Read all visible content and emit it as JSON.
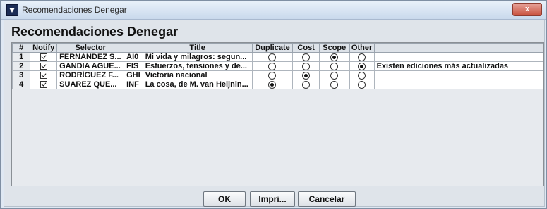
{
  "window": {
    "title": "Recomendaciones Denegar",
    "close_label": "x"
  },
  "heading": "Recomendaciones Denegar",
  "table": {
    "columns": [
      "#",
      "Notify",
      "Selector",
      "",
      "Title",
      "Duplicate",
      "Cost",
      "Scope",
      "Other",
      ""
    ],
    "rows": [
      {
        "num": "1",
        "notify": true,
        "selector": "FERNÁNDEZ S...",
        "code": "AI0",
        "title": "Mi vida y milagros: segun...",
        "choice": "Scope",
        "note": ""
      },
      {
        "num": "2",
        "notify": true,
        "selector": "GANDIA AGUE...",
        "code": "FIS",
        "title": "Esfuerzos, tensiones y de...",
        "choice": "Other",
        "note": "Existen ediciones más actualizadas"
      },
      {
        "num": "3",
        "notify": true,
        "selector": "RODRÍGUEZ F...",
        "code": "GHI",
        "title": "Victoria nacional",
        "choice": "Cost",
        "note": ""
      },
      {
        "num": "4",
        "notify": true,
        "selector": "SUAREZ QUE...",
        "code": "INF",
        "title": "La cosa, de M. van Heijnin...",
        "choice": "Duplicate",
        "note": ""
      }
    ]
  },
  "buttons": {
    "ok": "OK",
    "print": "Impri...",
    "cancel": "Cancelar"
  },
  "icons": {
    "app": "app-logo-icon",
    "close": "close-icon"
  }
}
